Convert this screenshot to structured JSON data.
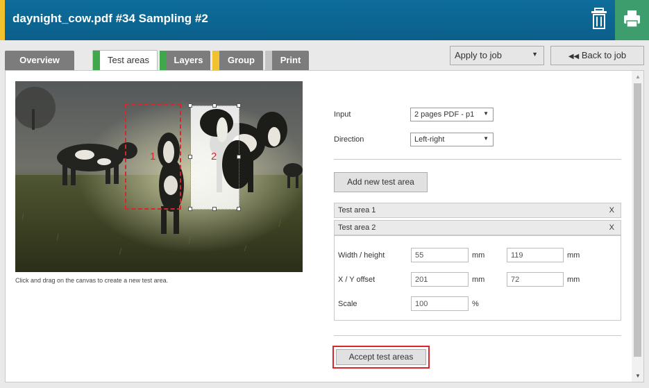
{
  "header": {
    "title": "daynight_cow.pdf #34 Sampling #2",
    "trash_icon": "trash-icon",
    "print_icon": "printer-icon",
    "accent_color": "#f2c12e"
  },
  "tabs": [
    {
      "label": "Overview"
    },
    {
      "label": "Test areas",
      "bar_color": "#3fa84c"
    },
    {
      "label": "Layers",
      "bar_color": "#3fa84c"
    },
    {
      "label": "Group",
      "bar_color": "#f2c12e"
    },
    {
      "label": "Print",
      "bar_color": "#c4c4c4"
    }
  ],
  "toolbar": {
    "apply_select": "Apply to job",
    "back_label": "Back to job"
  },
  "canvas": {
    "hint": "Click and drag on the canvas to create a new test area.",
    "area1_label": "1",
    "area2_label": "2"
  },
  "form": {
    "input_label": "Input",
    "input_value": "2 pages PDF - p1",
    "direction_label": "Direction",
    "direction_value": "Left-right",
    "add_button": "Add new test area",
    "areas": [
      {
        "label": "Test area 1",
        "close": "X"
      },
      {
        "label": "Test area 2",
        "close": "X"
      }
    ],
    "wh_label": "Width / height",
    "width": "55",
    "height": "119",
    "xy_label": "X / Y offset",
    "x_offset": "201",
    "y_offset": "72",
    "scale_label": "Scale",
    "scale": "100",
    "unit_mm": "mm",
    "unit_pct": "%",
    "accept_button": "Accept test areas"
  }
}
